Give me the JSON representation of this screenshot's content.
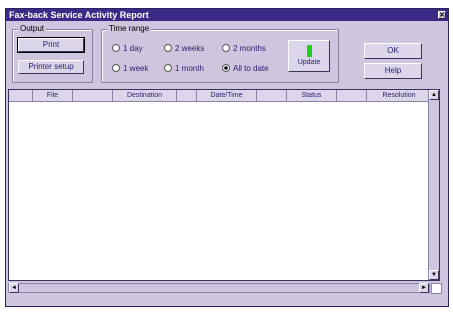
{
  "window": {
    "title": "Fax-back Service Activity Report",
    "close_glyph": "✕"
  },
  "output_group": {
    "label": "Output",
    "print_label": "Print",
    "printer_setup_label": "Printer setup"
  },
  "time_range_group": {
    "label": "Time range",
    "options": [
      {
        "label": "1 day",
        "selected": false
      },
      {
        "label": "2 weeks",
        "selected": false
      },
      {
        "label": "2 months",
        "selected": false
      },
      {
        "label": "1 week",
        "selected": false
      },
      {
        "label": "1 month",
        "selected": false
      },
      {
        "label": "All to date",
        "selected": true
      }
    ],
    "update_label": "Update",
    "update_indicator_color": "#21d11f"
  },
  "actions": {
    "ok_label": "OK",
    "help_label": "Help"
  },
  "list": {
    "columns": [
      "",
      "File",
      "",
      "Destination",
      "",
      "Date/Time",
      "",
      "Status",
      "",
      "Resolution"
    ]
  },
  "scroll": {
    "up": "▲",
    "down": "▼",
    "left": "◄",
    "right": "►"
  }
}
